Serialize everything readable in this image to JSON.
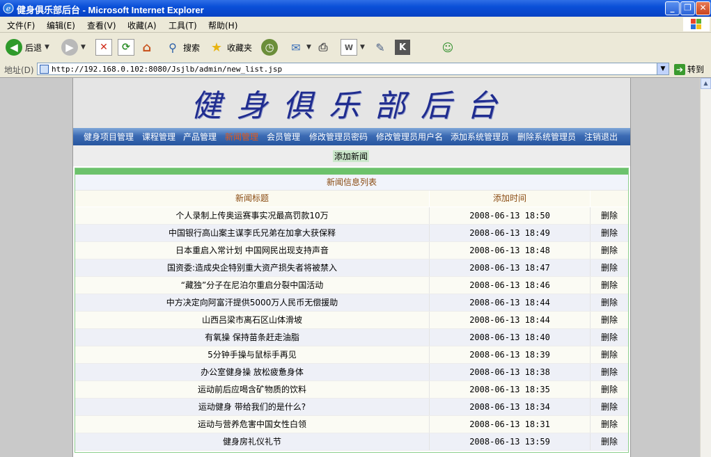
{
  "window": {
    "title": "健身俱乐部后台 - Microsoft Internet Explorer",
    "minimize": "_",
    "maximize": "❐",
    "close": "✕"
  },
  "menu": [
    {
      "label": "文件(F)"
    },
    {
      "label": "编辑(E)"
    },
    {
      "label": "查看(V)"
    },
    {
      "label": "收藏(A)"
    },
    {
      "label": "工具(T)"
    },
    {
      "label": "帮助(H)"
    }
  ],
  "toolbar": {
    "back": "后退",
    "search": "搜索",
    "favorites": "收藏夹",
    "icons": [
      "back-icon",
      "forward-icon",
      "stop-icon",
      "refresh-icon",
      "home-icon",
      "search-icon",
      "favorites-icon",
      "history-icon",
      "mail-icon",
      "print-icon",
      "edit-icon",
      "discuss-icon",
      "k-icon",
      "messenger-icon"
    ]
  },
  "address": {
    "label": "地址(D)",
    "url": "http://192.168.0.102:8080/Jsjlb/admin/new_list.jsp",
    "go": "转到"
  },
  "page": {
    "banner": "健身俱乐部后台",
    "nav": [
      {
        "label": "健身项目管理"
      },
      {
        "label": "课程管理"
      },
      {
        "label": "产品管理"
      },
      {
        "label": "新闻管理",
        "active": true
      },
      {
        "label": "会员管理"
      },
      {
        "label": "修改管理员密码"
      },
      {
        "label": "修改管理员用户名"
      },
      {
        "label": "添加系统管理员"
      },
      {
        "label": "删除系统管理员"
      },
      {
        "label": "注销退出"
      }
    ],
    "add_news": "添加新闻",
    "list_caption": "新闻信息列表",
    "columns": {
      "title": "新闻标题",
      "time": "添加时间",
      "action": ""
    },
    "delete_label": "删除",
    "rows": [
      {
        "title": "个人录制上传奥运赛事实况最高罚款10万",
        "time": "2008-06-13 18:50"
      },
      {
        "title": "中国银行高山案主谋李氏兄弟在加拿大获保释",
        "time": "2008-06-13 18:49"
      },
      {
        "title": "日本重启入常计划 中国网民出现支持声音",
        "time": "2008-06-13 18:48"
      },
      {
        "title": "国资委:造成央企特别重大资产损失者将被禁入",
        "time": "2008-06-13 18:47"
      },
      {
        "title": "“藏独”分子在尼泊尔重启分裂中国活动",
        "time": "2008-06-13 18:46"
      },
      {
        "title": "中方决定向阿富汗提供5000万人民币无偿援助",
        "time": "2008-06-13 18:44"
      },
      {
        "title": "山西吕梁市离石区山体滑坡",
        "time": "2008-06-13 18:44"
      },
      {
        "title": "有氧操 保持苗条赶走油脂",
        "time": "2008-06-13 18:40"
      },
      {
        "title": "5分钟手操与鼠标手再见",
        "time": "2008-06-13 18:39"
      },
      {
        "title": "办公室健身操 放松疲惫身体",
        "time": "2008-06-13 18:38"
      },
      {
        "title": "运动前后应喝含矿物质的饮料",
        "time": "2008-06-13 18:35"
      },
      {
        "title": "运动健身 带给我们的是什么?",
        "time": "2008-06-13 18:34"
      },
      {
        "title": "运动与营养危害中国女性白领",
        "time": "2008-06-13 18:31"
      },
      {
        "title": "健身房礼仪礼节",
        "time": "2008-06-13 13:59"
      }
    ]
  }
}
